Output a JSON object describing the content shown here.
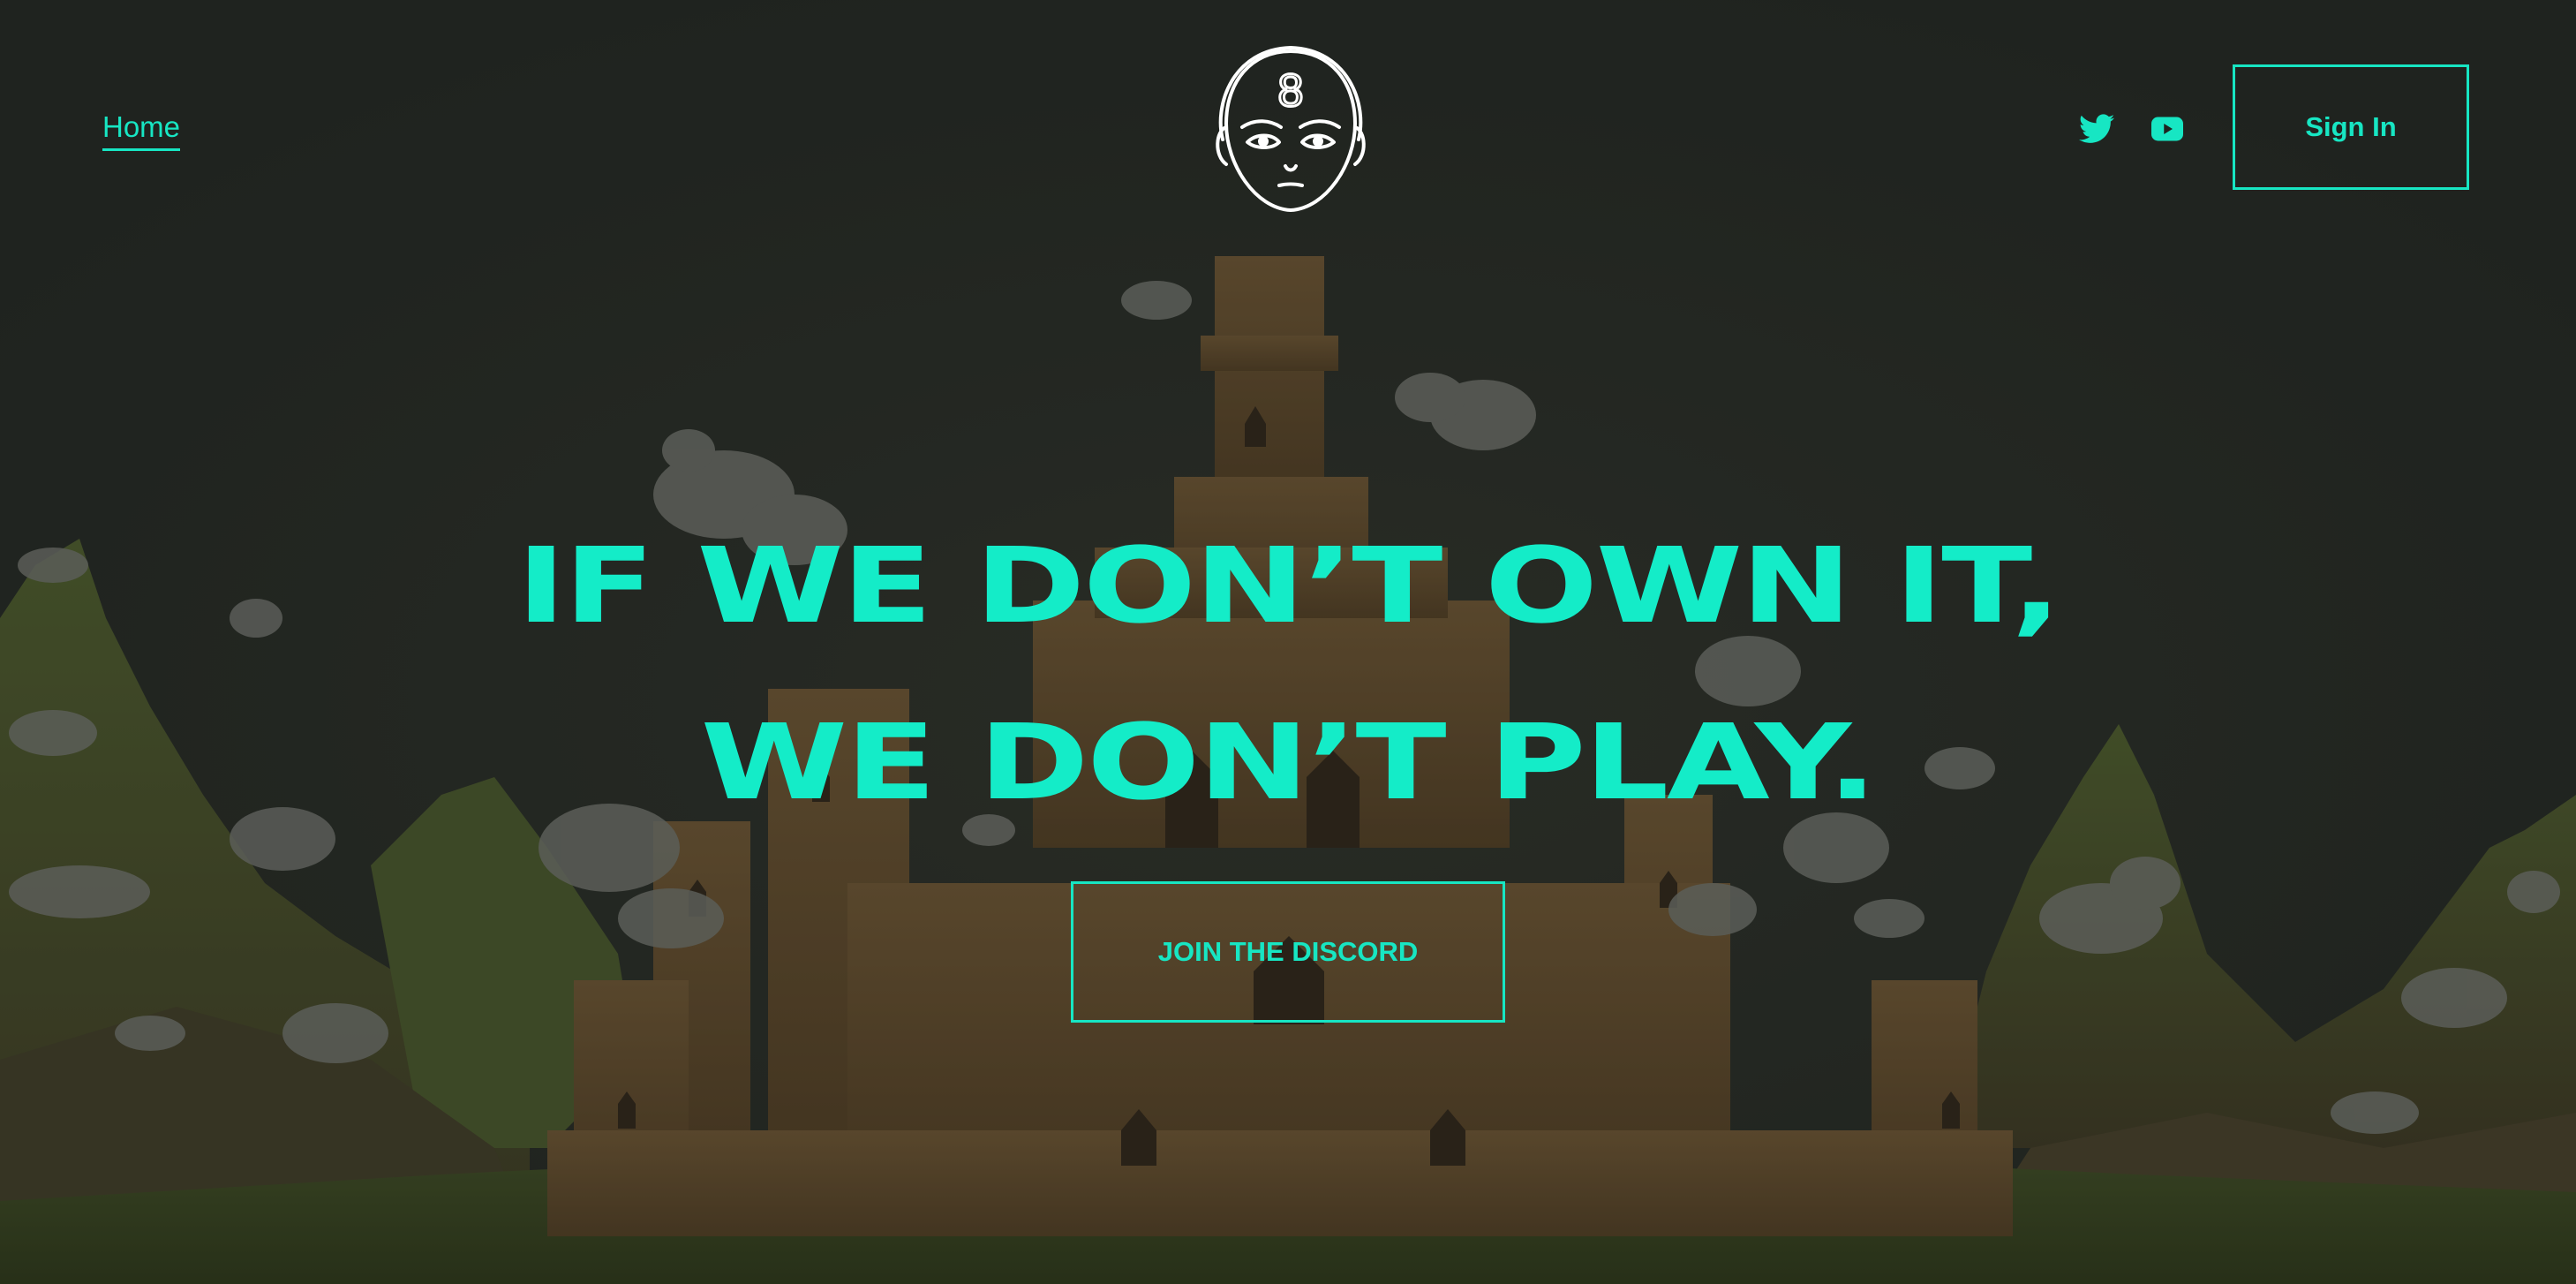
{
  "header": {
    "home_label": "Home",
    "logo_digit": "8",
    "signin_label": "Sign In",
    "social": [
      "twitter-icon",
      "youtube-icon"
    ]
  },
  "hero": {
    "line1": "IF WE DON’T OWN IT,",
    "line2": "WE DON’T PLAY.",
    "cta_label": "JOIN THE DISCORD"
  },
  "colors": {
    "accent": "#17e6c3",
    "background": "#1f231f",
    "logo": "#ffffff"
  }
}
